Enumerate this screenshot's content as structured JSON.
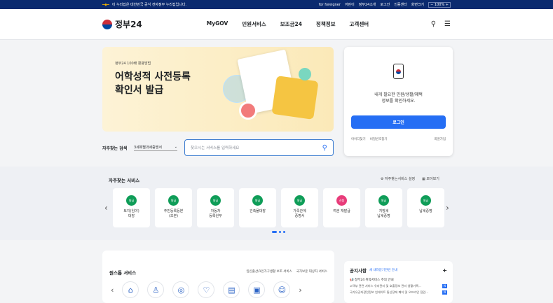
{
  "topbar": {
    "gov_notice": "이 누리집은 대한민국 공식 전자정부 누리집입니다.",
    "links": [
      "for foreigner",
      "어린이",
      "정부24소개",
      "로그인",
      "인증센터",
      "화면크기"
    ],
    "zoom": "100%"
  },
  "header": {
    "logo": "정부24",
    "nav": [
      "MyGOV",
      "민원서비스",
      "보조금24",
      "정책정보",
      "고객센터"
    ]
  },
  "hero": {
    "small": "정부24 100배 활용방법",
    "title_line1": "어학성적 사전등록",
    "title_line2": "확인서 발급"
  },
  "search": {
    "label": "자주찾는 검색",
    "select_value": "3세목별과세증명서",
    "placeholder": "찾으시는 서비스를 입력하세요"
  },
  "login": {
    "line1": "내게 필요한 민원/생활/혜택",
    "line2": "정보를 확인하세요.",
    "button": "로그인",
    "links": [
      "아이디찾기",
      "비밀번호찾기",
      "회원가입"
    ]
  },
  "frequent": {
    "title": "자주찾는 서비스",
    "settings": "자주찾는서비스 설정",
    "view_all": "모아보기",
    "cards": [
      {
        "badge": "발급",
        "label1": "토지(임야)",
        "label2": "대장",
        "color": "#0f9d58"
      },
      {
        "badge": "발급",
        "label1": "주민등록등본",
        "label2": "(초본)",
        "color": "#0f9d58"
      },
      {
        "badge": "발급",
        "label1": "자동차",
        "label2": "등록원부",
        "color": "#0f9d58"
      },
      {
        "badge": "발급",
        "label1": "건축물대장",
        "label2": "",
        "color": "#0f9d58"
      },
      {
        "badge": "발급",
        "label1": "가족관계",
        "label2": "증명서",
        "color": "#0f9d58"
      },
      {
        "badge": "신청",
        "label1": "여권 재발급",
        "label2": "",
        "color": "#e83c7a"
      },
      {
        "badge": "발급",
        "label1": "지방세",
        "label2": "납세증명",
        "color": "#0f9d58"
      },
      {
        "badge": "발급",
        "label1": "납세증명",
        "label2": "",
        "color": "#0f9d58"
      }
    ]
  },
  "onestop": {
    "title": "원스톱 서비스",
    "links": [
      "임신출산/1인가구생활 보조 서비스",
      "국가보훈 대상자 서비스"
    ]
  },
  "notice": {
    "title": "공지사항",
    "subtitle": "새 내려받기관련 안내",
    "item": "정부24 취약서비스 주의 안내",
    "rows": [
      "고객부 관련 서비스 유지관리 및 호출정보 관리 생활기록...",
      "국가유공자관련정보 업데이트 통신장애 폐지 및 오프라인 점검..."
    ]
  }
}
